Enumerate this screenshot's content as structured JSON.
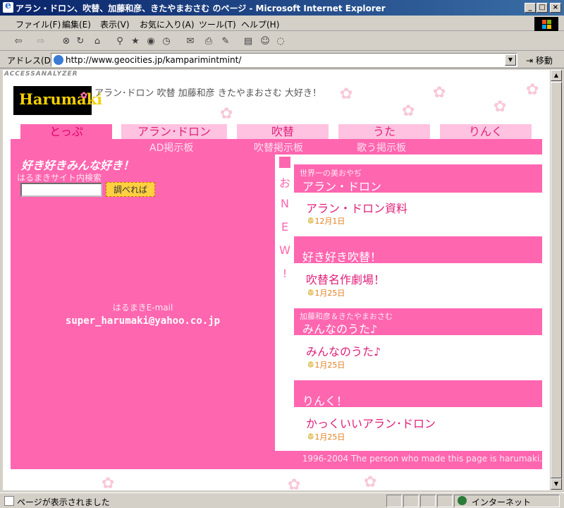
{
  "window": {
    "title": "アラン・ドロン、吹替、加藤和彦、きたやまおさむ のページ - Microsoft Internet Explorer",
    "controls": {
      "minimize": "_",
      "maximize": "□",
      "close": "×"
    }
  },
  "menu": [
    "ファイル(F)",
    "編集(E)",
    "表示(V)",
    "お気に入り(A)",
    "ツール(T)",
    "ヘルプ(H)"
  ],
  "address": {
    "label": "アドレス(D)",
    "url": "http://www.geocities.jp/kamparimintmint/",
    "go_label": "移動"
  },
  "status": {
    "text": "ページが表示されました",
    "zone": "インターネット"
  },
  "page": {
    "access_label": "ACCESSANALYZER",
    "logo_text": "Harumaki",
    "tagline": "アラン･ドロン 吹替 加藤和彦 きたやまおさむ 大好き！",
    "tabs": [
      "とっぷ",
      "アラン･ドロン",
      "吹替",
      "うた",
      "りんく"
    ],
    "subnav": [
      "AD掲示板",
      "吹替掲示板",
      "歌う掲示板"
    ],
    "left": {
      "title": "好き好きみんな好き！",
      "search_label": "はるまきサイト内検索",
      "search_value": "",
      "search_button": "調べれば",
      "email_label": "はるまきE-mail",
      "email": "super_harumaki@yahoo.co.jp"
    },
    "new_vertical": [
      "お",
      "N",
      "E",
      "W",
      "!"
    ],
    "sections": [
      {
        "sub": "世界一の美おやぢ",
        "title": "アラン・ドロン",
        "link": "アラン・ドロン資料",
        "date": "12月1日"
      },
      {
        "sub": "",
        "title": "好き好き吹替！",
        "link": "吹替名作劇場！",
        "date": "1月25日"
      },
      {
        "sub": "加藤和彦＆きたやまおさむ",
        "title": "みんなのうた♪",
        "link": "みんなのうた♪",
        "date": "1月25日"
      },
      {
        "sub": "",
        "title": "りんく！",
        "link": "かっくいいアラン･ドロン",
        "date": "1月25日"
      }
    ],
    "footer": "1996-2004 The person who made this page is harumaki."
  }
}
